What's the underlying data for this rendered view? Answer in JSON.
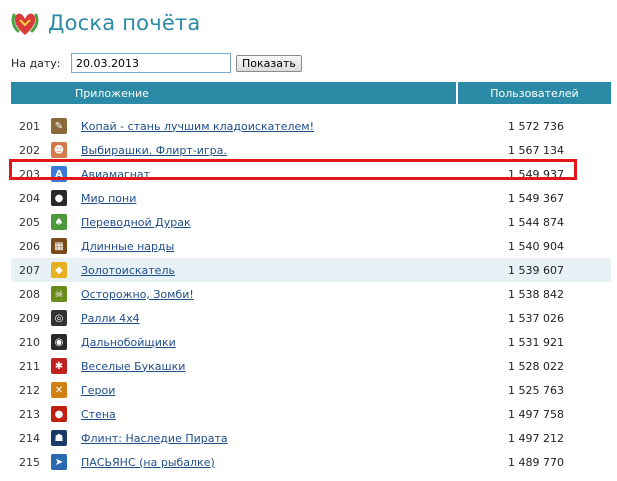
{
  "title": "Доска почёта",
  "date": {
    "label": "На дату:",
    "value": "20.03.2013",
    "button": "Показать"
  },
  "columns": {
    "app": "Приложение",
    "users": "Пользователей"
  },
  "rows": [
    {
      "rank": "201",
      "name": "Копай - стань лучшим кладоискателем!",
      "users": "1 572 736",
      "icon": "shovel-icon",
      "color": "#8a6a3a",
      "glyph": "✎"
    },
    {
      "rank": "202",
      "name": "Выбирашки. Флирт-игра.",
      "users": "1 567 134",
      "icon": "person-avatar-icon",
      "color": "#d27a4a",
      "glyph": "☻"
    },
    {
      "rank": "203",
      "name": "Авиамагнат",
      "users": "1 549 937",
      "icon": "airplane-icon",
      "color": "#3b7ad9",
      "glyph": "A"
    },
    {
      "rank": "204",
      "name": "Мир пони",
      "users": "1 549 367",
      "icon": "pony-icon",
      "color": "#2a2a2a",
      "glyph": "●"
    },
    {
      "rank": "205",
      "name": "Переводной Дурак",
      "users": "1 544 874",
      "icon": "cards-icon",
      "color": "#4a9a3a",
      "glyph": "♠"
    },
    {
      "rank": "206",
      "name": "Длинные нарды",
      "users": "1 540 904",
      "icon": "backgammon-icon",
      "color": "#7a4a1a",
      "glyph": "▦"
    },
    {
      "rank": "207",
      "name": "Золотоискатель",
      "users": "1 539 607",
      "icon": "gold-nugget-icon",
      "color": "#e6b020",
      "glyph": "◆"
    },
    {
      "rank": "208",
      "name": "Осторожно, Зомби!",
      "users": "1 538 842",
      "icon": "zombie-icon",
      "color": "#6a8a1a",
      "glyph": "☠"
    },
    {
      "rank": "209",
      "name": "Ралли 4x4",
      "users": "1 537 026",
      "icon": "wheel-icon",
      "color": "#333333",
      "glyph": "◎"
    },
    {
      "rank": "210",
      "name": "Дальнобойщики",
      "users": "1 531 921",
      "icon": "truck-icon",
      "color": "#2a2a2a",
      "glyph": "◉"
    },
    {
      "rank": "211",
      "name": "Веселые Букашки",
      "users": "1 528 022",
      "icon": "bug-icon",
      "color": "#c02020",
      "glyph": "✱"
    },
    {
      "rank": "212",
      "name": "Герои",
      "users": "1 525 763",
      "icon": "crossed-swords-icon",
      "color": "#d08010",
      "glyph": "✕"
    },
    {
      "rank": "213",
      "name": "Стена",
      "users": "1 497 758",
      "icon": "wall-icon",
      "color": "#c02010",
      "glyph": "●"
    },
    {
      "rank": "214",
      "name": "Флинт: Наследие Пирата",
      "users": "1 497 212",
      "icon": "pirate-icon",
      "color": "#1a3a6a",
      "glyph": "☗"
    },
    {
      "rank": "215",
      "name": "ПАСЬЯНС (на рыбалке)",
      "users": "1 489 770",
      "icon": "fish-icon",
      "color": "#2a6ab0",
      "glyph": "➤"
    }
  ],
  "highlighted_rank": "203"
}
